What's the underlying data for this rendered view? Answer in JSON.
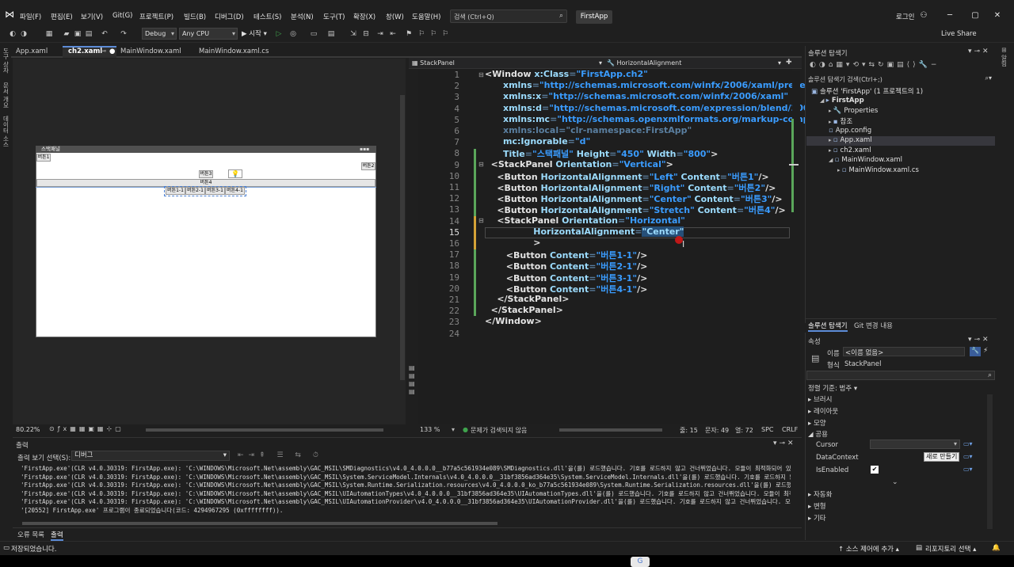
{
  "menu": {
    "items": [
      "파일(F)",
      "편집(E)",
      "보기(V)",
      "Git(G)",
      "프로젝트(P)",
      "빌드(B)",
      "디버그(D)",
      "테스트(S)",
      "분석(N)",
      "도구(T)",
      "확장(X)",
      "창(W)",
      "도움말(H)"
    ],
    "search_placeholder": "검색 (Ctrl+Q)",
    "app_title": "FirstApp",
    "login": "로그인"
  },
  "toolbar": {
    "config": "Debug",
    "platform": "Any CPU",
    "start_label": "▶ 시작 ▾",
    "live_share": "Live Share"
  },
  "left_strip": [
    "도구 상자",
    "문서 개요",
    "데이터 소스"
  ],
  "doc_tabs": [
    {
      "label": "App.xaml",
      "active": false
    },
    {
      "label": "ch2.xaml",
      "active": true
    },
    {
      "label": "MainWindow.xaml",
      "active": false
    },
    {
      "label": "MainWindow.xaml.cs",
      "active": false
    }
  ],
  "designer": {
    "window_title": "스택패널",
    "buttons": {
      "b1": "버튼1",
      "b2": "버튼2",
      "b3": "버튼3",
      "b4": "버튼4",
      "b11": "버튼1-1",
      "b21": "버튼2-1",
      "b31": "버튼3-1",
      "b41": "버튼4-1"
    },
    "zoom": "80.22%"
  },
  "editor": {
    "element_combo": "StackPanel",
    "property_combo": "HorizontalAlignment",
    "lines": [
      {
        "n": "1",
        "p": [
          [
            "tg",
            "<Window "
          ],
          [
            "at",
            "x:Class"
          ],
          [
            "cm",
            "="
          ],
          [
            "av",
            "\"FirstApp.ch2\""
          ]
        ]
      },
      {
        "n": "2",
        "p": [
          [
            "at",
            "      xmlns"
          ],
          [
            "cm",
            "="
          ],
          [
            "av",
            "\"http://schemas.microsoft.com/winfx/2006/xaml/presentati"
          ]
        ]
      },
      {
        "n": "3",
        "p": [
          [
            "at",
            "      xmlns:x"
          ],
          [
            "cm",
            "="
          ],
          [
            "av",
            "\"http://schemas.microsoft.com/winfx/2006/xaml\""
          ]
        ]
      },
      {
        "n": "4",
        "p": [
          [
            "at",
            "      xmlns:d"
          ],
          [
            "cm",
            "="
          ],
          [
            "av",
            "\"http://schemas.microsoft.com/expression/blend/2008\""
          ]
        ]
      },
      {
        "n": "5",
        "p": [
          [
            "at",
            "      xmlns:mc"
          ],
          [
            "cm",
            "="
          ],
          [
            "av",
            "\"http://schemas.openxmlformats.org/markup-compatib"
          ]
        ]
      },
      {
        "n": "6",
        "p": [
          [
            "cm",
            "      xmlns:local=\"clr-namespace:FirstApp\""
          ]
        ]
      },
      {
        "n": "7",
        "p": [
          [
            "at",
            "      mc:Ignorable"
          ],
          [
            "cm",
            "="
          ],
          [
            "av",
            "\"d\""
          ]
        ]
      },
      {
        "n": "8",
        "p": [
          [
            "at",
            "      Title"
          ],
          [
            "cm",
            "="
          ],
          [
            "av",
            "\"스택패널\""
          ],
          [
            "at",
            " Height"
          ],
          [
            "cm",
            "="
          ],
          [
            "av",
            "\"450\""
          ],
          [
            "at",
            " Width"
          ],
          [
            "cm",
            "="
          ],
          [
            "av",
            "\"800\""
          ],
          [
            "tg",
            ">"
          ]
        ]
      },
      {
        "n": "9",
        "p": [
          [
            "tg",
            "  <StackPanel "
          ],
          [
            "at",
            "Orientation"
          ],
          [
            "cm",
            "="
          ],
          [
            "av",
            "\"Vertical\""
          ],
          [
            "tg",
            ">"
          ]
        ]
      },
      {
        "n": "10",
        "p": [
          [
            "tg",
            "    <Button "
          ],
          [
            "at",
            "HorizontalAlignment"
          ],
          [
            "cm",
            "="
          ],
          [
            "av",
            "\"Left\""
          ],
          [
            "at",
            " Content"
          ],
          [
            "cm",
            "="
          ],
          [
            "av",
            "\"버튼1\""
          ],
          [
            "tg",
            "/>"
          ]
        ]
      },
      {
        "n": "11",
        "p": [
          [
            "tg",
            "    <Button "
          ],
          [
            "at",
            "HorizontalAlignment"
          ],
          [
            "cm",
            "="
          ],
          [
            "av",
            "\"Right\""
          ],
          [
            "at",
            " Content"
          ],
          [
            "cm",
            "="
          ],
          [
            "av",
            "\"버튼2\""
          ],
          [
            "tg",
            "/>"
          ]
        ]
      },
      {
        "n": "12",
        "p": [
          [
            "tg",
            "    <Button "
          ],
          [
            "at",
            "HorizontalAlignment"
          ],
          [
            "cm",
            "="
          ],
          [
            "av",
            "\"Center\""
          ],
          [
            "at",
            " Content"
          ],
          [
            "cm",
            "="
          ],
          [
            "av",
            "\"버튼3\""
          ],
          [
            "tg",
            "/>"
          ]
        ]
      },
      {
        "n": "13",
        "p": [
          [
            "tg",
            "    <Button "
          ],
          [
            "at",
            "HorizontalAlignment"
          ],
          [
            "cm",
            "="
          ],
          [
            "av",
            "\"Stretch\""
          ],
          [
            "at",
            " Content"
          ],
          [
            "cm",
            "="
          ],
          [
            "av",
            "\"버튼4\""
          ],
          [
            "tg",
            "/>"
          ]
        ]
      },
      {
        "n": "14",
        "p": [
          [
            "tg",
            "    <StackPanel "
          ],
          [
            "at",
            "Orientation"
          ],
          [
            "cm",
            "="
          ],
          [
            "av",
            "\"Horizontal\""
          ]
        ]
      },
      {
        "n": "15",
        "p": [
          [
            "at",
            "                HorizontalAlignment"
          ],
          [
            "cm",
            "="
          ],
          [
            "hl",
            "\"Center\""
          ]
        ]
      },
      {
        "n": "16",
        "p": [
          [
            "tg",
            "                >"
          ]
        ]
      },
      {
        "n": "17",
        "p": [
          [
            "tg",
            "       <Button "
          ],
          [
            "at",
            "Content"
          ],
          [
            "cm",
            "="
          ],
          [
            "av",
            "\"버튼1-1\""
          ],
          [
            "tg",
            "/>"
          ]
        ]
      },
      {
        "n": "18",
        "p": [
          [
            "tg",
            "       <Button "
          ],
          [
            "at",
            "Content"
          ],
          [
            "cm",
            "="
          ],
          [
            "av",
            "\"버튼2-1\""
          ],
          [
            "tg",
            "/>"
          ]
        ]
      },
      {
        "n": "19",
        "p": [
          [
            "tg",
            "       <Button "
          ],
          [
            "at",
            "Content"
          ],
          [
            "cm",
            "="
          ],
          [
            "av",
            "\"버튼3-1\""
          ],
          [
            "tg",
            "/>"
          ]
        ]
      },
      {
        "n": "20",
        "p": [
          [
            "tg",
            "       <Button "
          ],
          [
            "at",
            "Content"
          ],
          [
            "cm",
            "="
          ],
          [
            "av",
            "\"버튼4-1\""
          ],
          [
            "tg",
            "/>"
          ]
        ]
      },
      {
        "n": "21",
        "p": [
          [
            "tg",
            "    </StackPanel>"
          ]
        ]
      },
      {
        "n": "22",
        "p": [
          [
            "tg",
            "  </StackPanel>"
          ]
        ]
      },
      {
        "n": "23",
        "p": [
          [
            "tg",
            "</Window>"
          ]
        ]
      },
      {
        "n": "24",
        "p": []
      }
    ],
    "status": {
      "zoom": "133 %",
      "issues": "문제가 검색되지 않음",
      "line": "줄: 15",
      "char": "문자: 49",
      "col": "열: 72",
      "spc": "SPC",
      "crlf": "CRLF"
    }
  },
  "solution_explorer": {
    "title": "솔루션 탐색기",
    "search": "솔루션 탐색기 검색(Ctrl+;)",
    "items": [
      {
        "label": "솔루션 'FirstApp' (1 프로젝트의 1)",
        "indent": 0,
        "icon": "▣"
      },
      {
        "label": "FirstApp",
        "indent": 1,
        "icon": "▸"
      },
      {
        "label": "Properties",
        "indent": 2,
        "icon": "🔧"
      },
      {
        "label": "참조",
        "indent": 2,
        "icon": "▪"
      },
      {
        "label": "App.config",
        "indent": 2,
        "icon": "▫"
      },
      {
        "label": "App.xaml",
        "indent": 2,
        "icon": "▫"
      },
      {
        "label": "ch2.xaml",
        "indent": 2,
        "icon": "▫"
      },
      {
        "label": "MainWindow.xaml",
        "indent": 2,
        "icon": "▫"
      },
      {
        "label": "MainWindow.xaml.cs",
        "indent": 3,
        "icon": "▫"
      }
    ],
    "tabs": [
      "솔루션 탐색기",
      "Git 변경 내용"
    ]
  },
  "properties": {
    "title": "속성",
    "name_label": "이름",
    "name_value": "<이름 없음>",
    "type_label": "형식",
    "type_value": "StackPanel",
    "sort": "정렬 기준: 범주 ▾",
    "categories": [
      "브러시",
      "레이아웃",
      "모양",
      "공용"
    ],
    "rows": [
      {
        "label": "Cursor",
        "value": ""
      },
      {
        "label": "DataContext",
        "value": "새로 만들기"
      },
      {
        "label": "IsEnabled",
        "value": "✔"
      }
    ],
    "bottom_categories": [
      "자동화",
      "변형",
      "기타"
    ]
  },
  "output": {
    "title": "출력",
    "source_label": "출력 보기 선택(S):",
    "source_value": "디버그",
    "lines": [
      "'FirstApp.exe'(CLR v4.0.30319: FirstApp.exe): 'C:\\WINDOWS\\Microsoft.Net\\assembly\\GAC_MSIL\\SMDiagnostics\\v4.0_4.0.0.0__b77a5c561934e089\\SMDiagnostics.dll'을(를) 로드했습니다. 기호를 로드하지 않고 건너뛰었습니다. 모듈이 최적화되어 있고 '내 코드만",
      "'FirstApp.exe'(CLR v4.0.30319: FirstApp.exe): 'C:\\WINDOWS\\Microsoft.Net\\assembly\\GAC_MSIL\\System.ServiceModel.Internals\\v4.0_4.0.0.0__31bf3856ad364e35\\System.ServiceModel.Internals.dll'을(를) 로드했습니다. 기호를 로드하지 않고 건너뛰었습니다.",
      "'FirstApp.exe'(CLR v4.0.30319: FirstApp.exe): 'C:\\WINDOWS\\Microsoft.Net\\assembly\\GAC_MSIL\\System.Runtime.Serialization.resources\\v4.0_4.0.0.0_ko_b77a5c561934e089\\System.Runtime.Serialization.resources.dll'을(를) 로드했습니다. 모듈이 기호 없이",
      "'FirstApp.exe'(CLR v4.0.30319: FirstApp.exe): 'C:\\WINDOWS\\Microsoft.Net\\assembly\\GAC_MSIL\\UIAutomationTypes\\v4.0_4.0.0.0__31bf3856ad364e35\\UIAutomationTypes.dll'을(를) 로드했습니다. 기호를 로드하지 않고 건너뛰었습니다. 모듈이 최적화되어 있고",
      "'FirstApp.exe'(CLR v4.0.30319: FirstApp.exe): 'C:\\WINDOWS\\Microsoft.Net\\assembly\\GAC_MSIL\\UIAutomationProvider\\v4.0_4.0.0.0__31bf3856ad364e35\\UIAutomationProvider.dll'을(를) 로드했습니다. 기호를 로드하지 않고 건너뛰었습니다. 모듈이 최적화되어",
      "'[20552] FirstApp.exe' 프로그램이 종료되었습니다(코드: 4294967295 (0xffffffff))."
    ],
    "tabs": [
      "오류 목록",
      "출력"
    ]
  },
  "statusbar": {
    "left": "저장되었습니다.",
    "source_control": "↑ 소스 제어에 추가 ▴",
    "repo": "리포지토리 선택 ▴"
  },
  "colors": {
    "accent": "#5c8bd6",
    "attribute": "#9cdcfe",
    "value": "#3a9cff",
    "selection": "#264f78"
  }
}
